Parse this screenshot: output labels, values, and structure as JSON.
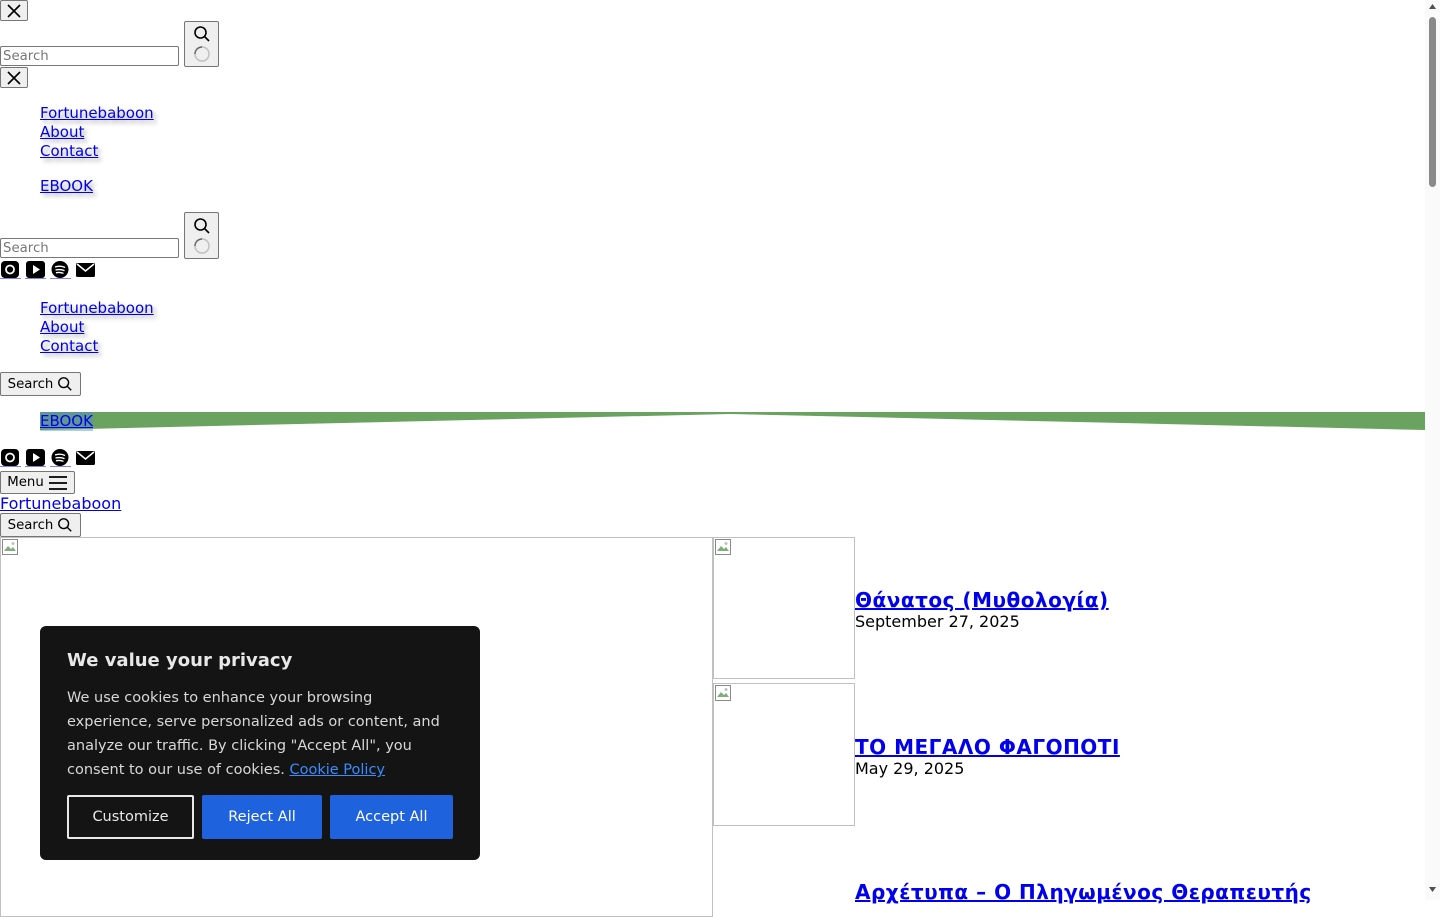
{
  "search": {
    "placeholder": "Search",
    "button_label": "Search"
  },
  "nav": {
    "items": [
      "Fortunebaboon",
      "About",
      "Contact"
    ],
    "ebook": "EBOOK"
  },
  "header": {
    "menu_label": "Menu",
    "site_title": "Fortunebaboon"
  },
  "social_icons": [
    "instagram-icon",
    "youtube-icon",
    "spotify-icon",
    "email-icon"
  ],
  "posts": [
    {
      "title": "Θάνατος (Μυθολογία)",
      "date": "September 27, 2025"
    },
    {
      "title": "ΤΟ ΜΕΓΑΛΟ ΦΑΓΟΠΟΤΙ",
      "date": "May 29, 2025"
    },
    {
      "title": "Αρχέτυπα – Ο Πληγωμένος Θεραπευτής",
      "date": ""
    }
  ],
  "cookie": {
    "title": "We value your privacy",
    "body": "We use cookies to enhance your browsing experience, serve personalized ads or content, and analyze our traffic. By clicking \"Accept All\", you consent to our use of cookies. ",
    "policy_link": "Cookie Policy",
    "customize": "Customize",
    "reject": "Reject All",
    "accept": "Accept All"
  },
  "colors": {
    "accent_green": "#6aa35f",
    "cookie_bg": "#141414",
    "cookie_button_blue": "#1e63dd",
    "link": "#0000ee"
  }
}
